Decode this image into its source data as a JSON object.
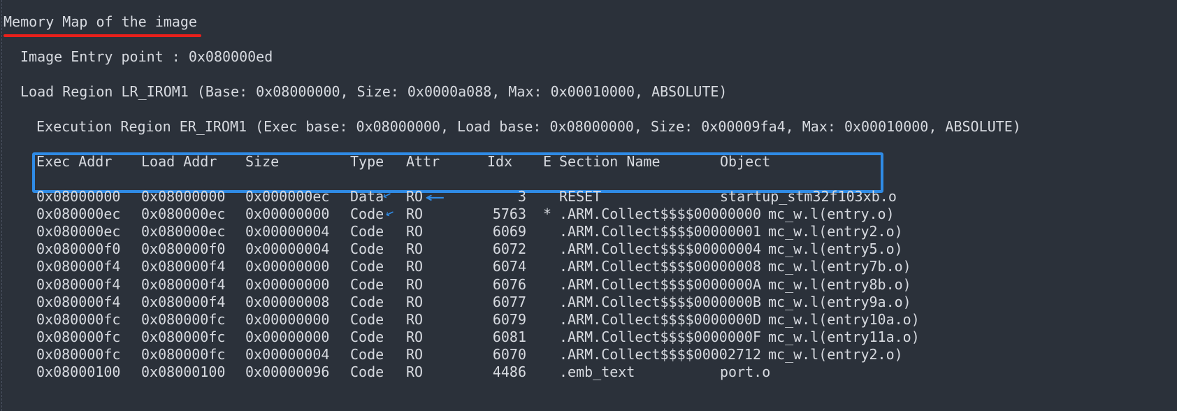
{
  "title": "Memory Map of the image",
  "entry_point": "Image Entry point : 0x080000ed",
  "load_region": "Load Region LR_IROM1 (Base: 0x08000000, Size: 0x0000a088, Max: 0x00010000, ABSOLUTE)",
  "exec_region": "Execution Region ER_IROM1 (Exec base: 0x08000000, Load base: 0x08000000, Size: 0x00009fa4, Max: 0x00010000, ABSOLUTE)",
  "columns": [
    "Exec Addr",
    "Load Addr",
    "Size",
    "Type",
    "Attr",
    "Idx",
    "E",
    "Section Name",
    "Object"
  ],
  "rows": [
    {
      "exec": "0x08000000",
      "load": "0x08000000",
      "size": "0x000000ec",
      "type": "Data",
      "attr": "RO",
      "idx": "3",
      "e": "",
      "section": "RESET",
      "object": "startup_stm32f103xb.o"
    },
    {
      "exec": "0x080000ec",
      "load": "0x080000ec",
      "size": "0x00000000",
      "type": "Code",
      "attr": "RO",
      "idx": "5763",
      "e": "*",
      "section": ".ARM.Collect$$$$00000000",
      "object": "mc_w.l(entry.o)"
    },
    {
      "exec": "0x080000ec",
      "load": "0x080000ec",
      "size": "0x00000004",
      "type": "Code",
      "attr": "RO",
      "idx": "6069",
      "e": "",
      "section": ".ARM.Collect$$$$00000001",
      "object": "mc_w.l(entry2.o)"
    },
    {
      "exec": "0x080000f0",
      "load": "0x080000f0",
      "size": "0x00000004",
      "type": "Code",
      "attr": "RO",
      "idx": "6072",
      "e": "",
      "section": ".ARM.Collect$$$$00000004",
      "object": "mc_w.l(entry5.o)"
    },
    {
      "exec": "0x080000f4",
      "load": "0x080000f4",
      "size": "0x00000000",
      "type": "Code",
      "attr": "RO",
      "idx": "6074",
      "e": "",
      "section": ".ARM.Collect$$$$00000008",
      "object": "mc_w.l(entry7b.o)"
    },
    {
      "exec": "0x080000f4",
      "load": "0x080000f4",
      "size": "0x00000000",
      "type": "Code",
      "attr": "RO",
      "idx": "6076",
      "e": "",
      "section": ".ARM.Collect$$$$0000000A",
      "object": "mc_w.l(entry8b.o)"
    },
    {
      "exec": "0x080000f4",
      "load": "0x080000f4",
      "size": "0x00000008",
      "type": "Code",
      "attr": "RO",
      "idx": "6077",
      "e": "",
      "section": ".ARM.Collect$$$$0000000B",
      "object": "mc_w.l(entry9a.o)"
    },
    {
      "exec": "0x080000fc",
      "load": "0x080000fc",
      "size": "0x00000000",
      "type": "Code",
      "attr": "RO",
      "idx": "6079",
      "e": "",
      "section": ".ARM.Collect$$$$0000000D",
      "object": "mc_w.l(entry10a.o)"
    },
    {
      "exec": "0x080000fc",
      "load": "0x080000fc",
      "size": "0x00000000",
      "type": "Code",
      "attr": "RO",
      "idx": "6081",
      "e": "",
      "section": ".ARM.Collect$$$$0000000F",
      "object": "mc_w.l(entry11a.o)"
    },
    {
      "exec": "0x080000fc",
      "load": "0x080000fc",
      "size": "0x00000004",
      "type": "Code",
      "attr": "RO",
      "idx": "6070",
      "e": "",
      "section": ".ARM.Collect$$$$00002712",
      "object": "mc_w.l(entry2.o)"
    },
    {
      "exec": "0x08000100",
      "load": "0x08000100",
      "size": "0x00000096",
      "type": "Code",
      "attr": "RO",
      "idx": "4486",
      "e": "",
      "section": ".emb_text",
      "object": "port.o"
    }
  ],
  "annotations": {
    "arrow_glyph": "←",
    "highlight_color": "#2f8be6",
    "underline_color": "#e8201b"
  }
}
